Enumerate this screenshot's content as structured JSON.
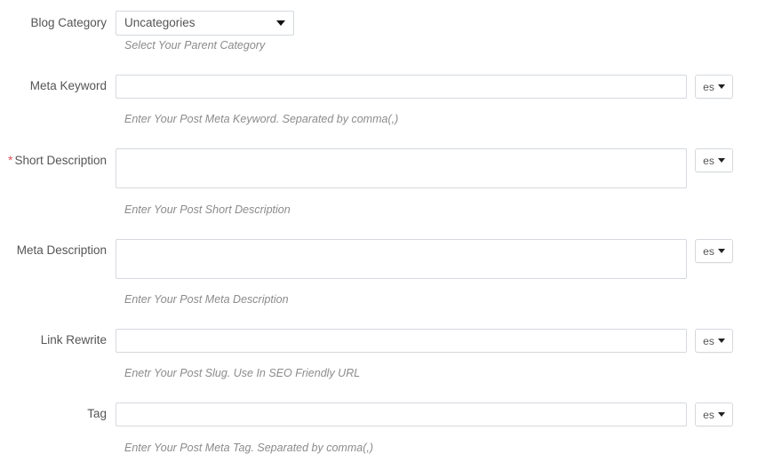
{
  "form": {
    "rows": [
      {
        "id": "category",
        "label": "Blog Category",
        "required": false,
        "control": "select",
        "value": "Uncategories",
        "helper": "Select Your Parent Category",
        "lang": null
      },
      {
        "id": "metakeyword",
        "label": "Meta Keyword",
        "required": false,
        "control": "input",
        "value": "",
        "placeholder": "",
        "helper": "Enter Your Post Meta Keyword. Separated by comma(,)",
        "lang": "es"
      },
      {
        "id": "shortdesc",
        "label": "Short Description",
        "required": true,
        "control": "textarea",
        "value": "",
        "placeholder": "",
        "helper": "Enter Your Post Short Description",
        "lang": "es"
      },
      {
        "id": "metadesc",
        "label": "Meta Description",
        "required": false,
        "control": "textarea",
        "value": "",
        "placeholder": "",
        "helper": "Enter Your Post Meta Description",
        "lang": "es"
      },
      {
        "id": "linkrewrite",
        "label": "Link Rewrite",
        "required": false,
        "control": "input",
        "value": "",
        "placeholder": "",
        "helper": "Enetr Your Post Slug. Use In SEO Friendly URL",
        "lang": "es"
      },
      {
        "id": "tag",
        "label": "Tag",
        "required": false,
        "control": "input",
        "value": "",
        "placeholder": "",
        "helper": "Enter Your Post Meta Tag. Separated by comma(,)",
        "lang": "es"
      }
    ],
    "required_marker": "*",
    "colors": {
      "label": "#555555",
      "helper": "#8b8b8b",
      "required": "#e4525f",
      "border": "#d5d9dd",
      "background": "#ffffff"
    }
  }
}
